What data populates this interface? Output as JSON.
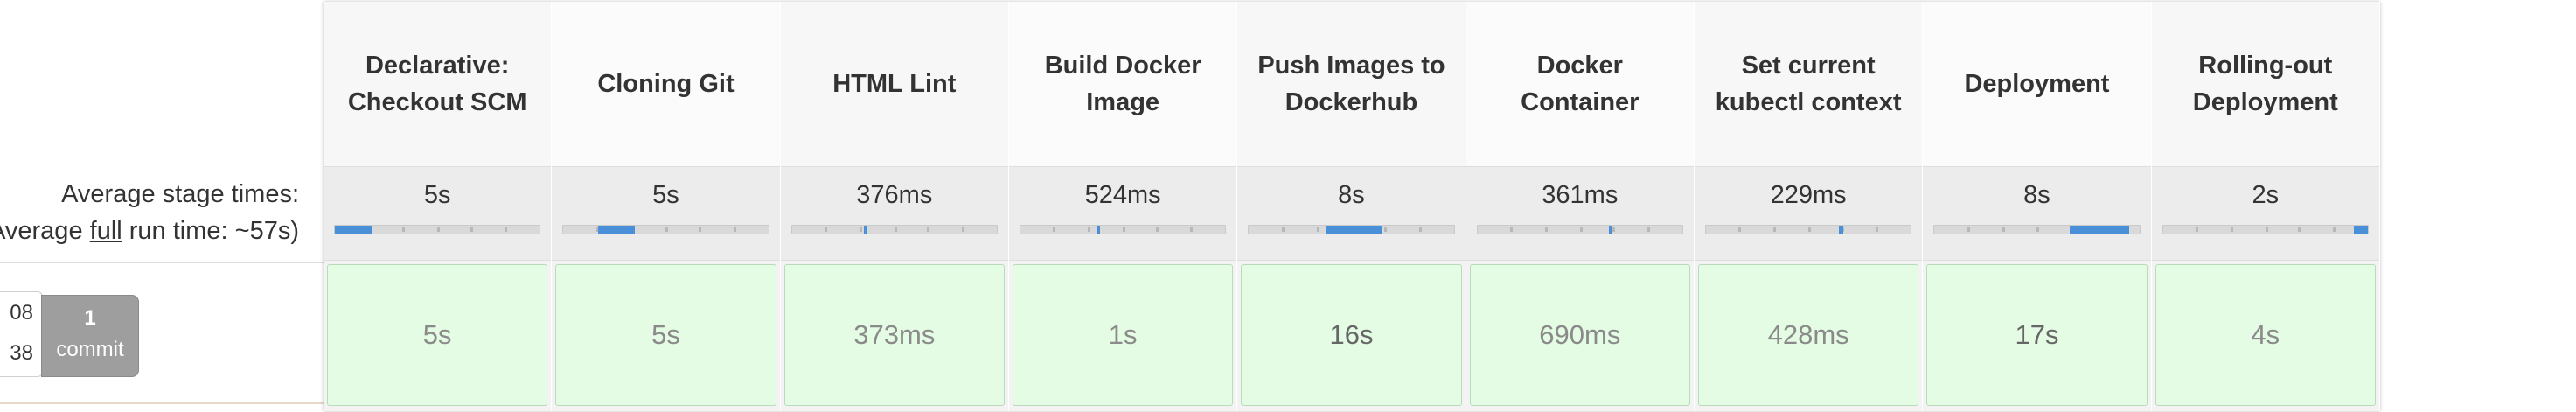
{
  "summary": {
    "average_stage_times_label": "Average stage times:",
    "full_run_prefix": "(Average ",
    "full_run_word": "full",
    "full_run_suffix": " run time: ~57s)"
  },
  "run": {
    "line1": "08",
    "line2": "38",
    "commit_count": "1",
    "commit_word": "commit"
  },
  "stages": [
    {
      "name": "Declarative: Checkout SCM",
      "avg": "5s",
      "result": "5s",
      "bar_start": 0.0,
      "bar_end": 0.18
    },
    {
      "name": "Cloning Git",
      "avg": "5s",
      "result": "5s",
      "bar_start": 0.17,
      "bar_end": 0.35
    },
    {
      "name": "HTML Lint",
      "avg": "376ms",
      "result": "373ms",
      "bar_start": 0.35,
      "bar_end": 0.37
    },
    {
      "name": "Build Docker Image",
      "avg": "524ms",
      "result": "1s",
      "bar_start": 0.37,
      "bar_end": 0.39
    },
    {
      "name": "Push Images to Dockerhub",
      "avg": "8s",
      "result": "16s",
      "bar_start": 0.38,
      "bar_end": 0.65
    },
    {
      "name": "Docker Container",
      "avg": "361ms",
      "result": "690ms",
      "bar_start": 0.64,
      "bar_end": 0.66
    },
    {
      "name": "Set current kubectl context",
      "avg": "229ms",
      "result": "428ms",
      "bar_start": 0.65,
      "bar_end": 0.67
    },
    {
      "name": "Deployment",
      "avg": "8s",
      "result": "17s",
      "bar_start": 0.66,
      "bar_end": 0.95
    },
    {
      "name": "Rolling-out Deployment",
      "avg": "2s",
      "result": "4s",
      "bar_start": 0.93,
      "bar_end": 1.0
    }
  ],
  "colors": {
    "result_bg": "#e4fbe4",
    "bar_fill": "#4a90d9",
    "commit_badge": "#9e9e9e"
  }
}
